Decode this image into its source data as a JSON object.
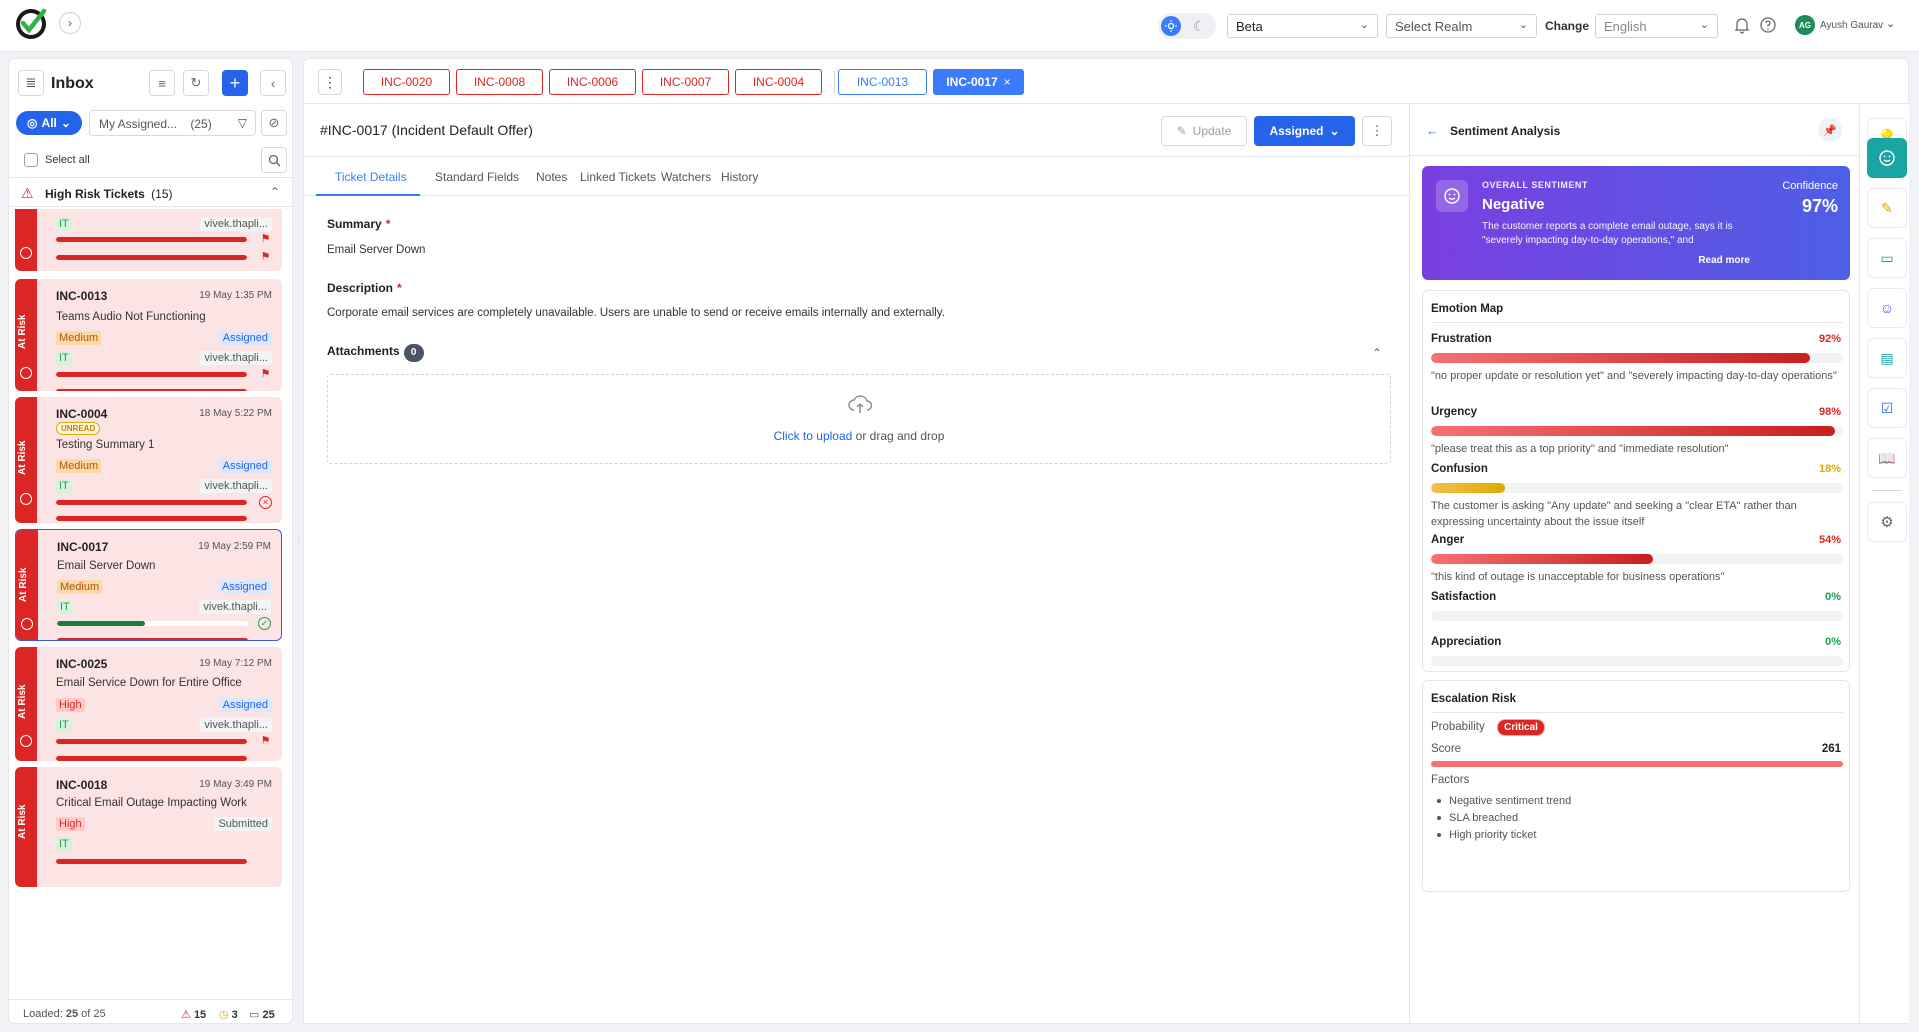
{
  "topbar": {
    "environment": "Beta",
    "realm_placeholder": "Select Realm",
    "change_label": "Change",
    "language": "English",
    "user_initials": "AG",
    "user_name": "Ayush Gaurav"
  },
  "inbox": {
    "title": "Inbox",
    "filter_all": "All",
    "assigned_filter": "My Assigned...",
    "assigned_count": "(25)",
    "select_all": "Select all",
    "group_label": "High Risk Tickets",
    "group_count": "(15)",
    "risk_label": "At Risk",
    "cards": [
      {
        "id": "",
        "time": "",
        "title": "",
        "priority": "",
        "status": "",
        "dept": "IT",
        "assignee": "vivek.thapli..."
      },
      {
        "id": "INC-0013",
        "time": "19 May 1:35 PM",
        "title": "Teams Audio Not Functioning",
        "priority": "Medium",
        "status": "Assigned",
        "dept": "IT",
        "assignee": "vivek.thapli..."
      },
      {
        "id": "INC-0004",
        "time": "18 May 5:22 PM",
        "unread": "UNREAD",
        "title": "Testing Summary 1",
        "priority": "Medium",
        "status": "Assigned",
        "dept": "IT",
        "assignee": "vivek.thapli..."
      },
      {
        "id": "INC-0017",
        "time": "19 May 2:59 PM",
        "title": "Email Server Down",
        "priority": "Medium",
        "status": "Assigned",
        "dept": "IT",
        "assignee": "vivek.thapli...",
        "response_progress": 0.46
      },
      {
        "id": "INC-0025",
        "time": "19 May 7:12 PM",
        "title": "Email Service Down for Entire Office",
        "priority": "High",
        "status": "Assigned",
        "dept": "IT",
        "assignee": "vivek.thapli..."
      },
      {
        "id": "INC-0018",
        "time": "19 May 3:49 PM",
        "title": "Critical Email Outage Impacting Work",
        "priority": "High",
        "status": "Submitted",
        "dept": "IT",
        "assignee": ""
      }
    ],
    "footer": {
      "loaded_prefix": "Loaded:",
      "loaded": "25",
      "of_text": "of 25",
      "risk_count": "15",
      "warn_count": "3",
      "total_count": "25"
    }
  },
  "ticket_tabs": [
    "INC-0020",
    "INC-0008",
    "INC-0006",
    "INC-0007",
    "INC-0004",
    "INC-0013",
    "INC-0017"
  ],
  "ticket": {
    "heading": "#INC-0017",
    "template": "(Incident Default Offer)",
    "update_label": "Update",
    "status_label": "Assigned",
    "tabs": [
      "Ticket Details",
      "Standard Fields",
      "Notes",
      "Linked Tickets",
      "Watchers",
      "History"
    ],
    "summary_label": "Summary",
    "summary": "Email Server Down",
    "description_label": "Description",
    "description": "Corporate email services are completely unavailable. Users are unable to send or receive emails internally and externally.",
    "attachments_label": "Attachments",
    "attachments_count": "0",
    "upload_link": "Click to upload",
    "upload_rest": "or drag and drop"
  },
  "sentiment": {
    "title": "Sentiment Analysis",
    "overall_label": "OVERALL SENTIMENT",
    "overall": "Negative",
    "confidence_label": "Confidence",
    "confidence": "97%",
    "summary": "The customer reports a complete email outage, says it is \"severely impacting day-to-day operations,\" and",
    "read_more": "Read more",
    "emotion_map_title": "Emotion Map",
    "emotions": [
      {
        "name": "Frustration",
        "pct": "92%",
        "value": 0.92,
        "color": "#dc2626",
        "quote": "\"no proper update or resolution yet\" and \"severely impacting day-to-day operations\""
      },
      {
        "name": "Urgency",
        "pct": "98%",
        "value": 0.98,
        "color": "#dc2626",
        "quote": "\"please treat this as a top priority\" and \"immediate resolution\""
      },
      {
        "name": "Confusion",
        "pct": "18%",
        "value": 0.18,
        "color": "#e0a800",
        "quote": "The customer is asking \"Any update\" and seeking a \"clear ETA\" rather than expressing uncertainty about the issue itself"
      },
      {
        "name": "Anger",
        "pct": "54%",
        "value": 0.54,
        "color": "#dc2626",
        "quote": "\"this kind of outage is unacceptable for business operations\""
      },
      {
        "name": "Satisfaction",
        "pct": "0%",
        "value": 0,
        "color": "#16a34a",
        "quote": ""
      },
      {
        "name": "Appreciation",
        "pct": "0%",
        "value": 0,
        "color": "#16a34a",
        "quote": ""
      }
    ],
    "escalation_title": "Escalation Risk",
    "probability_label": "Probability",
    "probability": "Critical",
    "score_label": "Score",
    "score": "261",
    "factors_label": "Factors",
    "factors": [
      "Negative sentiment trend",
      "SLA breached",
      "High priority ticket"
    ]
  },
  "colors": {
    "primary": "#2563eb",
    "risk": "#dc2626",
    "accent": "#1aa5a5"
  }
}
